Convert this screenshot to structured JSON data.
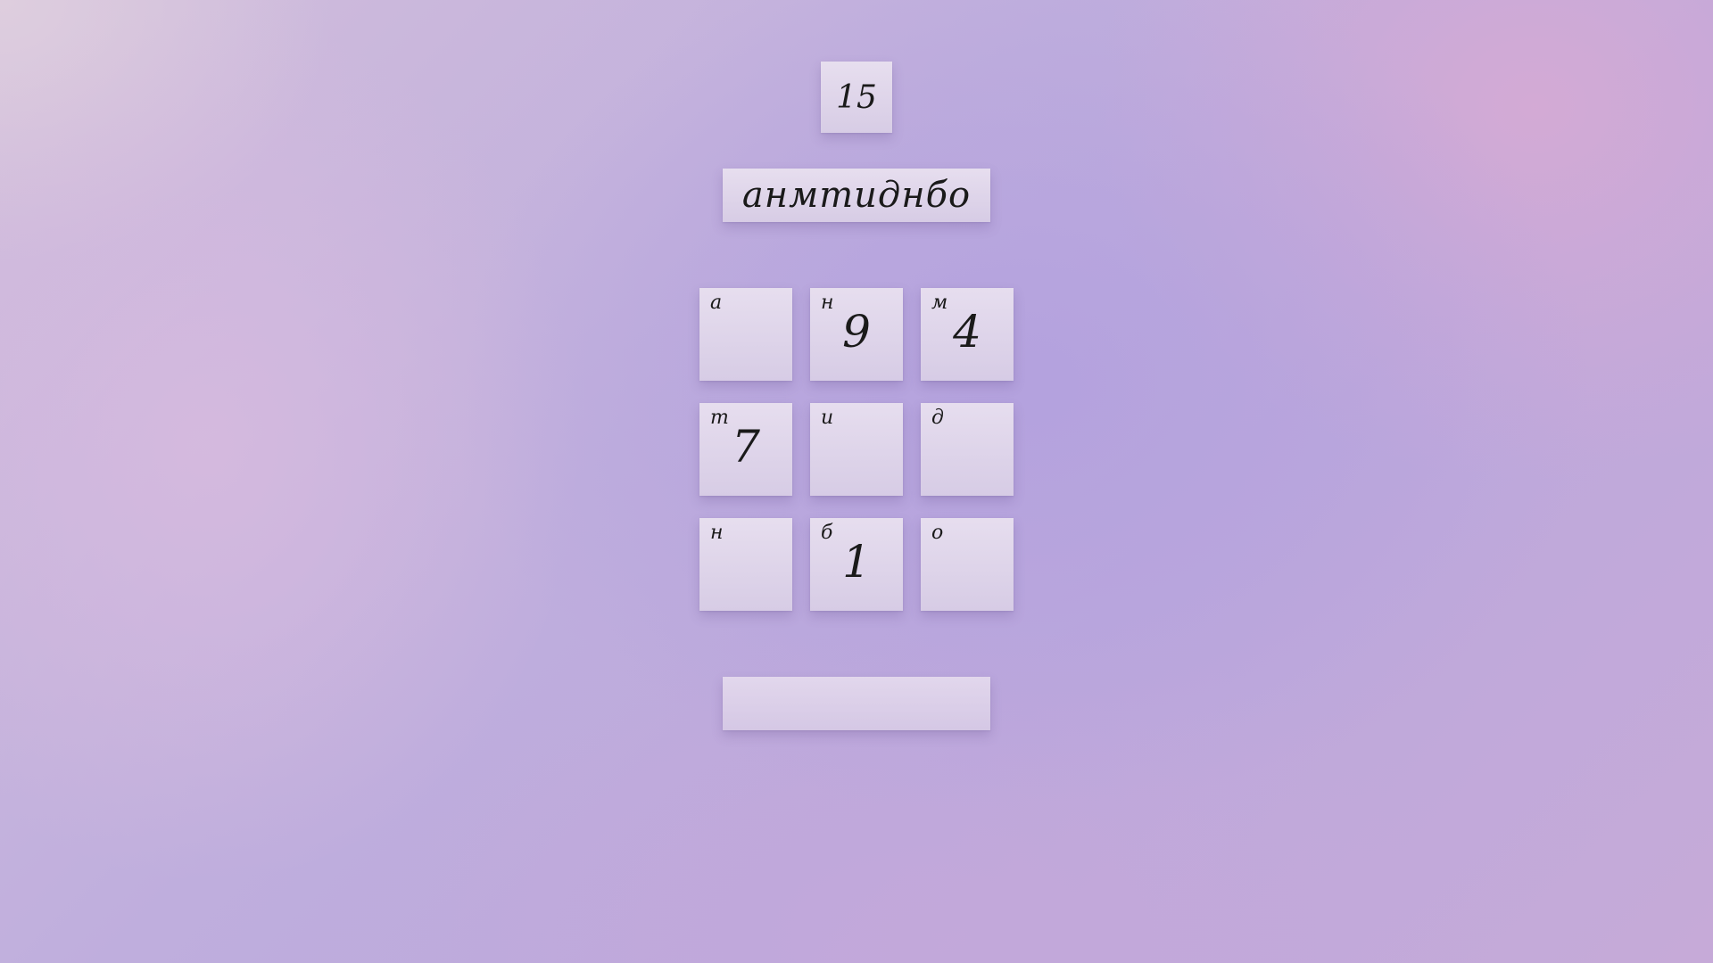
{
  "counter": "15",
  "word": "анмтиднбо",
  "answer_value": "",
  "grid": [
    {
      "letter": "а",
      "number": ""
    },
    {
      "letter": "н",
      "number": "9"
    },
    {
      "letter": "м",
      "number": "4"
    },
    {
      "letter": "т",
      "number": "7"
    },
    {
      "letter": "и",
      "number": ""
    },
    {
      "letter": "д",
      "number": ""
    },
    {
      "letter": "н",
      "number": ""
    },
    {
      "letter": "б",
      "number": "1"
    },
    {
      "letter": "о",
      "number": ""
    }
  ]
}
